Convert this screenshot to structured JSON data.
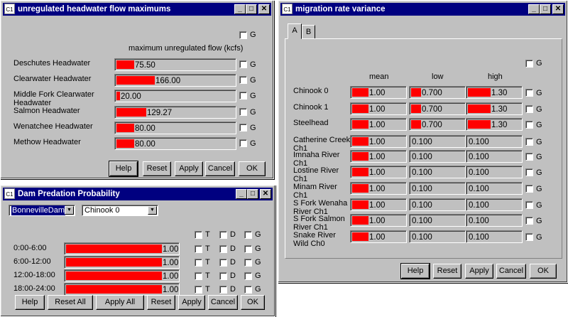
{
  "icons": {
    "app": "C1",
    "minimize": "_",
    "maximize": "□",
    "close": "✕",
    "dropdown": "▼"
  },
  "colors": {
    "bar": "#ff0000",
    "titlebar": "#000080",
    "face": "#c0c0c0"
  },
  "hw": {
    "title": "unregulated headwater flow maximums",
    "header": "maximum unregulated flow (kcfs)",
    "g": "G",
    "rows": [
      {
        "label": "Deschutes Headwater",
        "value": "75.50",
        "fraction": 0.15
      },
      {
        "label": "Clearwater Headwater",
        "value": "166.00",
        "fraction": 0.32
      },
      {
        "label": "Middle Fork Clearwater Headwater",
        "value": "20.00",
        "fraction": 0.03
      },
      {
        "label": "Salmon Headwater",
        "value": "129.27",
        "fraction": 0.25
      },
      {
        "label": "Wenatchee Headwater",
        "value": "80.00",
        "fraction": 0.15
      },
      {
        "label": "Methow Headwater",
        "value": "80.00",
        "fraction": 0.15
      }
    ],
    "buttons": {
      "help": "Help",
      "reset": "Reset",
      "apply": "Apply",
      "cancel": "Cancel",
      "ok": "OK"
    }
  },
  "dam": {
    "title": "Dam Predation Probability",
    "dam_select": "BonnevilleDam",
    "species_select": "Chinook 0",
    "flags": {
      "t": "T",
      "d": "D",
      "g": "G"
    },
    "rows": [
      {
        "label": "0:00-6:00",
        "value": "1.00",
        "fraction": 1.0
      },
      {
        "label": "6:00-12:00",
        "value": "1.00",
        "fraction": 1.0
      },
      {
        "label": "12:00-18:00",
        "value": "1.00",
        "fraction": 1.0
      },
      {
        "label": "18:00-24:00",
        "value": "1.00",
        "fraction": 1.0
      }
    ],
    "buttons": {
      "help": "Help",
      "reset_all": "Reset All",
      "apply_all": "Apply All",
      "reset": "Reset",
      "apply": "Apply",
      "cancel": "Cancel",
      "ok": "OK"
    }
  },
  "mig": {
    "title": "migration rate variance",
    "tabs": [
      "A",
      "B"
    ],
    "g": "G",
    "columns": [
      "mean",
      "low",
      "high"
    ],
    "rows": [
      {
        "label": "Chinook 0",
        "mean": "1.00",
        "mean_f": 0.3,
        "low": "0.700",
        "low_f": 0.18,
        "high": "1.30",
        "high_f": 0.42
      },
      {
        "label": "Chinook 1",
        "mean": "1.00",
        "mean_f": 0.3,
        "low": "0.700",
        "low_f": 0.18,
        "high": "1.30",
        "high_f": 0.42
      },
      {
        "label": "Steelhead",
        "mean": "1.00",
        "mean_f": 0.3,
        "low": "0.700",
        "low_f": 0.18,
        "high": "1.30",
        "high_f": 0.42
      },
      {
        "label": "Catherine Creek Ch1",
        "mean": "1.00",
        "mean_f": 0.3,
        "low": "0.100",
        "low_f": 0,
        "high": "0.100",
        "high_f": 0
      },
      {
        "label": "Imnaha River Ch1",
        "mean": "1.00",
        "mean_f": 0.3,
        "low": "0.100",
        "low_f": 0,
        "high": "0.100",
        "high_f": 0
      },
      {
        "label": "Lostine River Ch1",
        "mean": "1.00",
        "mean_f": 0.3,
        "low": "0.100",
        "low_f": 0,
        "high": "0.100",
        "high_f": 0
      },
      {
        "label": "Minam River Ch1",
        "mean": "1.00",
        "mean_f": 0.3,
        "low": "0.100",
        "low_f": 0,
        "high": "0.100",
        "high_f": 0
      },
      {
        "label": "S Fork Wenaha River Ch1",
        "mean": "1.00",
        "mean_f": 0.3,
        "low": "0.100",
        "low_f": 0,
        "high": "0.100",
        "high_f": 0
      },
      {
        "label": "S Fork Salmon River Ch1",
        "mean": "1.00",
        "mean_f": 0.3,
        "low": "0.100",
        "low_f": 0,
        "high": "0.100",
        "high_f": 0
      },
      {
        "label": "Snake River Wild Ch0",
        "mean": "1.00",
        "mean_f": 0.3,
        "low": "0.100",
        "low_f": 0,
        "high": "0.100",
        "high_f": 0
      }
    ],
    "buttons": {
      "help": "Help",
      "reset": "Reset",
      "apply": "Apply",
      "cancel": "Cancel",
      "ok": "OK"
    }
  }
}
